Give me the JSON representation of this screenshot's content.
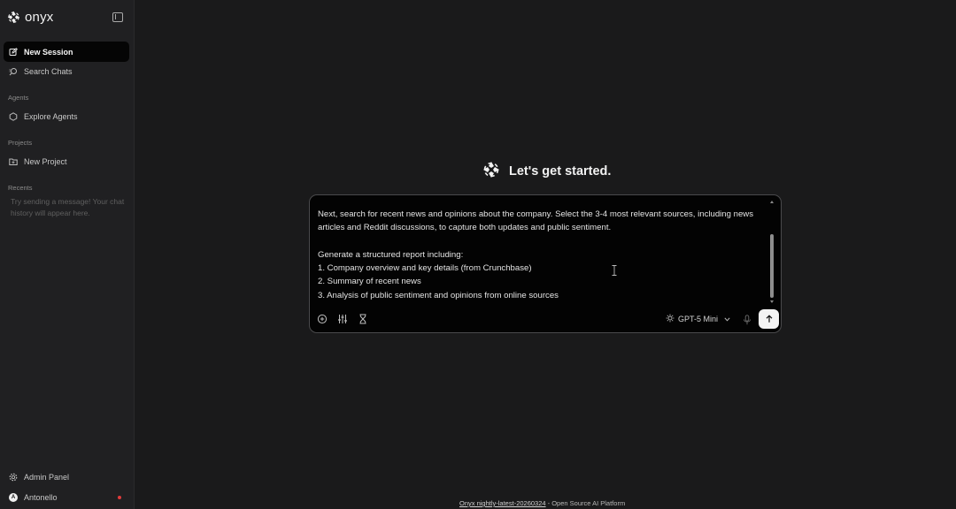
{
  "sidebar": {
    "brand": "onyx",
    "items": [
      {
        "label": "New Session"
      },
      {
        "label": "Search Chats"
      },
      {
        "label": "Explore Agents"
      },
      {
        "label": "New Project"
      }
    ],
    "sections": {
      "agents": "Agents",
      "projects": "Projects",
      "recents": "Recents"
    },
    "recents_hint": "Try sending a message! Your chat history will appear here.",
    "admin_panel": "Admin Panel",
    "user": {
      "name": "Antonello",
      "initial": "A"
    }
  },
  "main": {
    "welcome_title": "Let's get started.",
    "composer": {
      "text": "Next, search for recent news and opinions about the company. Select the 3-4 most relevant sources, including news articles and Reddit discussions, to capture both updates and public sentiment.\n\nGenerate a structured report including:\n1. Company overview and key details (from Crunchbase)\n2. Summary of recent news\n3. Analysis of public sentiment and opinions from online sources",
      "model": "GPT-5 Mini"
    }
  },
  "footer": {
    "version_link": "Onyx nightly-latest-20260324",
    "tagline": " - Open Source AI Platform"
  },
  "colors": {
    "sidebar_bg": "#202022",
    "main_bg": "#1a1a1b",
    "composer_bg": "#030303",
    "active_item_bg": "#050505",
    "send_button": "#f4f4f4",
    "status_dot": "#e23b3b"
  }
}
